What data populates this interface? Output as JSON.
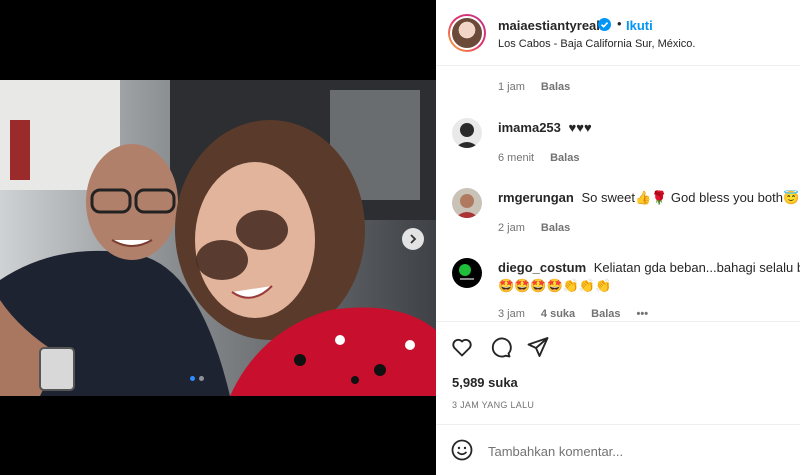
{
  "post": {
    "username": "maiaestiantyreal",
    "follow_label": "Ikuti",
    "separator": "•",
    "location": "Los Cabos - Baja California Sur, México."
  },
  "comments": [
    {
      "meta": {
        "time": "1 jam",
        "reply": "Balas"
      }
    },
    {
      "username": "imama253",
      "text": "♥♥♥",
      "meta": {
        "time": "6 menit",
        "reply": "Balas"
      }
    },
    {
      "username": "rmgerungan",
      "text": "So sweet👍🌹 God bless you both😇",
      "meta": {
        "time": "2 jam",
        "reply": "Balas"
      }
    },
    {
      "username": "diego_costum",
      "text": "Keliatan gda beban...bahagi selalu bu",
      "text2": "🤩🤩🤩🤩👏👏👏",
      "meta": {
        "time": "3 jam",
        "likes": "4 suka",
        "reply": "Balas",
        "more": "•••"
      }
    }
  ],
  "actions": {
    "like": "heart-icon",
    "comment": "comment-icon",
    "share": "share-icon"
  },
  "likes_text": "5,989 suka",
  "time_ago": "3 JAM YANG LALU",
  "comment_box": {
    "placeholder": "Tambahkan komentar..."
  },
  "carousel": {
    "slides": 2,
    "current": 1
  }
}
